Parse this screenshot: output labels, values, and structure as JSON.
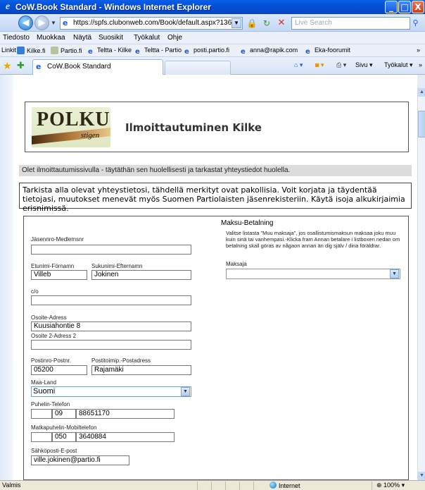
{
  "window": {
    "title": "CoW.Book Standard - Windows Internet Explorer",
    "min_glyph": "_",
    "max_glyph": "□",
    "close_glyph": "X"
  },
  "address": {
    "url": "https://spfs.clubonweb.com/Book/default.aspx?13687",
    "search_placeholder": "Live Search"
  },
  "menu": {
    "items": [
      "Tiedosto",
      "Muokkaa",
      "Näytä",
      "Suosikit",
      "Työkalut",
      "Ohje"
    ]
  },
  "links": {
    "label": "Linkit",
    "items": [
      "Kilke.fi",
      "Partio.fi",
      "Teltta - Kilke",
      "Teltta - Partio",
      "posti.partio.fi",
      "anna@rapik.com",
      "Eka-foorumit"
    ]
  },
  "tabs": {
    "active_label": "CoW.Book Standard",
    "tools": [
      "Sivu ▾",
      "Työkalut ▾"
    ]
  },
  "page": {
    "logo_main": "POLKU",
    "logo_sub": "stigen",
    "title": "Ilmoittautuminen Kilke",
    "info": "Olet ilmoittautumissivulla - täytäthän sen huolellisesti ja tarkastat yhteystiedot huolella.",
    "notice": "Tarkista alla olevat yhteystietosi, tähdellä merkityt ovat pakollisia. Voit korjata ja täydentää tietojasi, muutokset menevät myös Suomen Partiolaisten jäsenrekisteriin. Käytä isoja alkukirjaimia erisnimissä."
  },
  "form": {
    "member_label": "Jäsennro-Medlemsnr",
    "member_value": "",
    "firstname_label": "Etunimi-Förnamn",
    "firstname_value": "Villeb",
    "lastname_label": "Sukunimi-Efternamn",
    "lastname_value": "Jokinen",
    "co_label": "c/o",
    "co_value": "",
    "address_label": "Osoite-Adress",
    "address_value": "Kuusiahontie 8",
    "address2_label": "Osoite 2-Adress 2",
    "address2_value": "",
    "zip_label": "Postinro-Postnr.",
    "zip_value": "05200",
    "city_label": "Postitoimip.-Postadress",
    "city_value": "Rajamäki",
    "country_label": "Maa-Land",
    "country_value": "Suomi",
    "phone_label": "Puhelin-Telefon",
    "phone_cc": "",
    "phone_area": "09",
    "phone_number": "88651170",
    "mobile_label": "Matkapuhelin-Mobiltelefon",
    "mobile_cc": "",
    "mobile_area": "050",
    "mobile_number": "3640884",
    "email_label": "Sähköposti-E-post",
    "email_value": "ville.jokinen@partio.fi"
  },
  "payment": {
    "title": "Maksu-Betalning",
    "text": "Valitse listasta \"Muu maksaja\", jos osallistumismaksun maksaa joku muu kuin sinä tai vanhempasi.-Klicka fram Annan betalare i listboxen nedan om betalning skall göras av någaon annan än dig själv / dina föräldrar.",
    "payer_label": "Maksaja",
    "payer_value": ""
  },
  "status": {
    "text": "Valmis",
    "zone": "Internet",
    "zoom": "100%"
  }
}
